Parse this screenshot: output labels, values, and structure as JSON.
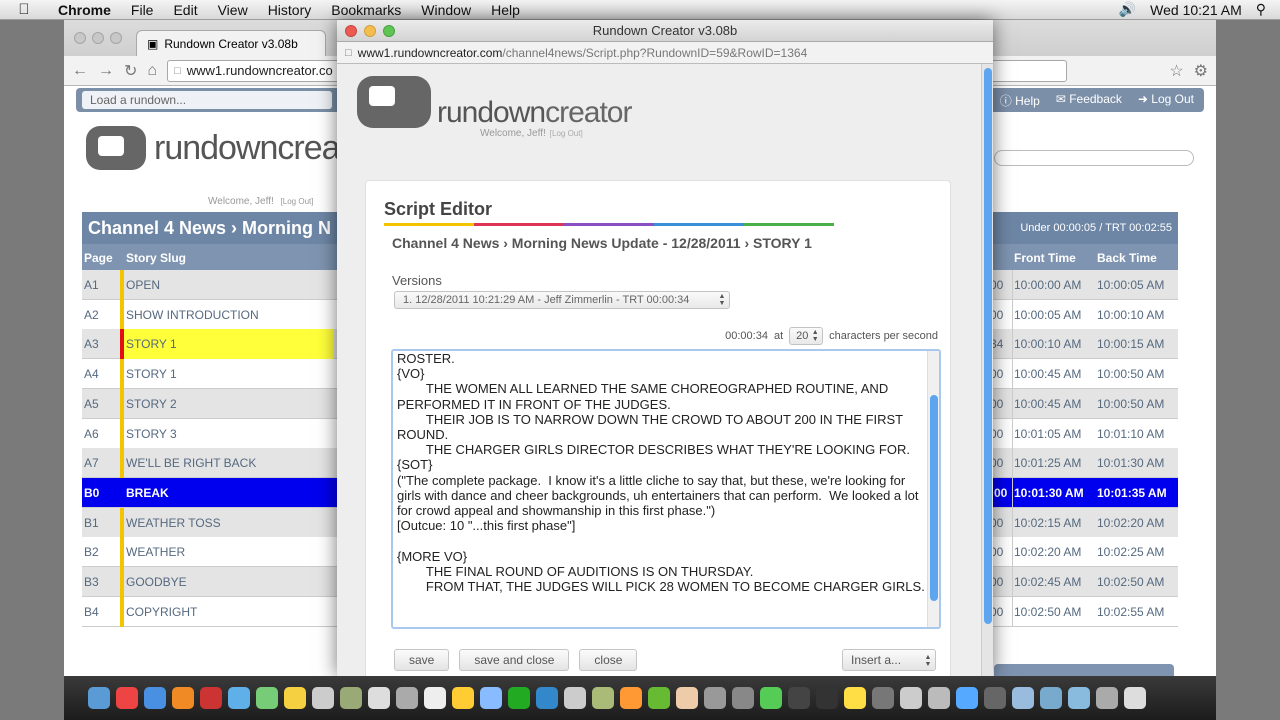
{
  "menubar": {
    "app": "Chrome",
    "menus": [
      "File",
      "Edit",
      "View",
      "History",
      "Bookmarks",
      "Window",
      "Help"
    ],
    "clock": "Wed 10:21 AM"
  },
  "background_window": {
    "tab_title": "Rundown Creator v3.08b",
    "url": "www1.rundowncreator.co",
    "load_placeholder": "Load a rundown...",
    "links": [
      "Help",
      "Feedback",
      "Log Out"
    ],
    "logo_text": "rundowncrea",
    "welcome": "Welcome, Jeff!",
    "logout_small": "[Log Out]",
    "rundown_title": "Channel 4 News › Morning N",
    "under_trt": "Under 00:00:05 / TRT 00:02:55",
    "columns": {
      "page": "Page",
      "slug": "Story Slug",
      "partial": "l",
      "front": "Front Time",
      "back": "Back Time"
    },
    "rows": [
      {
        "page": "A1",
        "slug": "OPEN",
        "partial": "00",
        "front": "10:00:00 AM",
        "back": "10:00:05 AM"
      },
      {
        "page": "A2",
        "slug": "SHOW INTRODUCTION",
        "partial": "00",
        "front": "10:00:05 AM",
        "back": "10:00:10 AM"
      },
      {
        "page": "A3",
        "slug": "STORY 1",
        "partial": "34",
        "front": "10:00:10 AM",
        "back": "10:00:15 AM"
      },
      {
        "page": "A4",
        "slug": "STORY 1",
        "partial": "00",
        "front": "10:00:45 AM",
        "back": "10:00:50 AM"
      },
      {
        "page": "A5",
        "slug": "STORY 2",
        "partial": "00",
        "front": "10:00:45 AM",
        "back": "10:00:50 AM"
      },
      {
        "page": "A6",
        "slug": "STORY 3",
        "partial": "00",
        "front": "10:01:05 AM",
        "back": "10:01:10 AM"
      },
      {
        "page": "A7",
        "slug": "WE'LL BE RIGHT BACK",
        "partial": "00",
        "front": "10:01:25 AM",
        "back": "10:01:30 AM"
      },
      {
        "page": "B0",
        "slug": "BREAK",
        "partial": ":00",
        "front": "10:01:30 AM",
        "back": "10:01:35 AM"
      },
      {
        "page": "B1",
        "slug": "WEATHER TOSS",
        "partial": "00",
        "front": "10:02:15 AM",
        "back": "10:02:20 AM"
      },
      {
        "page": "B2",
        "slug": "WEATHER",
        "partial": "00",
        "front": "10:02:20 AM",
        "back": "10:02:25 AM"
      },
      {
        "page": "B3",
        "slug": "GOODBYE",
        "partial": "00",
        "front": "10:02:45 AM",
        "back": "10:02:50 AM"
      },
      {
        "page": "B4",
        "slug": "COPYRIGHT",
        "partial": "00",
        "front": "10:02:50 AM",
        "back": "10:02:55 AM"
      }
    ]
  },
  "popup": {
    "window_title": "Rundown Creator v3.08b",
    "url_host": "www1.rundowncreator.com",
    "url_path": "/channel4news/Script.php?RundownID=59&RowID=1364",
    "logo_light": "rundown",
    "logo_dark": "creator",
    "welcome": "Welcome, Jeff!",
    "logout_small": "[Log Out]",
    "editor_title": "Script Editor",
    "breadcrumb": "Channel 4 News › Morning News Update - 12/28/2011 › STORY 1",
    "versions_label": "Versions",
    "version_selected": "1. 12/28/2011 10:21:29 AM - Jeff Zimmerlin - TRT 00:00:34",
    "duration": "00:00:34",
    "at_label": "at",
    "cps_value": "20",
    "cps_label": "characters per second",
    "script_text": "ROSTER.\n{VO}\n        THE WOMEN ALL LEARNED THE SAME CHOREOGRAPHED ROUTINE, AND PERFORMED IT IN FRONT OF THE JUDGES.\n        THEIR JOB IS TO NARROW DOWN THE CROWD TO ABOUT 200 IN THE FIRST ROUND.\n        THE CHARGER GIRLS DIRECTOR DESCRIBES WHAT THEY'RE LOOKING FOR.\n{SOT}\n(\"The complete package.  I know it's a little cliche to say that, but these, we're looking for girls with dance and cheer backgrounds, uh entertainers that can perform.  We looked a lot for crowd appeal and showmanship in this first phase.\")\n[Outcue: 10 \"...this first phase\"]\n\n{MORE VO}\n        THE FINAL ROUND OF AUDITIONS IS ON THURSDAY.\n        FROM THAT, THE JUDGES WILL PICK 28 WOMEN TO BECOME CHARGER GIRLS.",
    "buttons": {
      "save": "save",
      "save_close": "save and close",
      "close": "close"
    },
    "insert_label": "Insert a..."
  },
  "colors": {
    "header_blue": "#6e86a5",
    "break_blue": "#0000ee",
    "selected_yellow": "#ffff3a",
    "accent_scroll": "#5da6ef"
  }
}
